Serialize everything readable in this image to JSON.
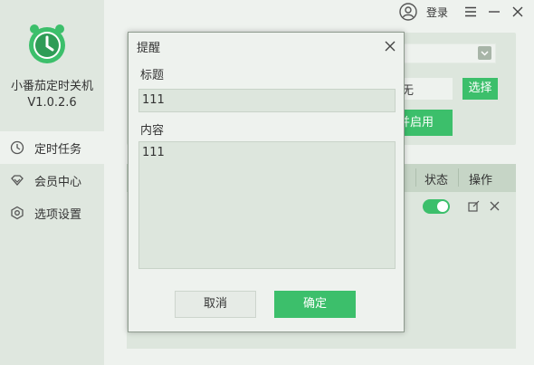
{
  "app": {
    "name": "小番茄定时关机",
    "version": "V1.0.2.6"
  },
  "sidebar": {
    "items": [
      {
        "label": "定时任务",
        "icon": "clock-icon",
        "active": true
      },
      {
        "label": "会员中心",
        "icon": "diamond-icon",
        "active": false
      },
      {
        "label": "选项设置",
        "icon": "hexagon-settings-icon",
        "active": false
      }
    ]
  },
  "titlebar": {
    "login_label": "登录"
  },
  "main": {
    "partial_input_value": "无",
    "choose_button": "选择",
    "enable_button": "并启用",
    "table": {
      "headers": [
        "状态",
        "操作"
      ],
      "row_status_on": true
    }
  },
  "dialog": {
    "title": "提醒",
    "title_label": "标题",
    "title_value": "111",
    "content_label": "内容",
    "content_value": "111",
    "cancel_label": "取消",
    "ok_label": "确定"
  },
  "colors": {
    "accent": "#3cbf6b",
    "sidebar_bg": "#dfe7df",
    "page_bg": "#eef2ee"
  }
}
